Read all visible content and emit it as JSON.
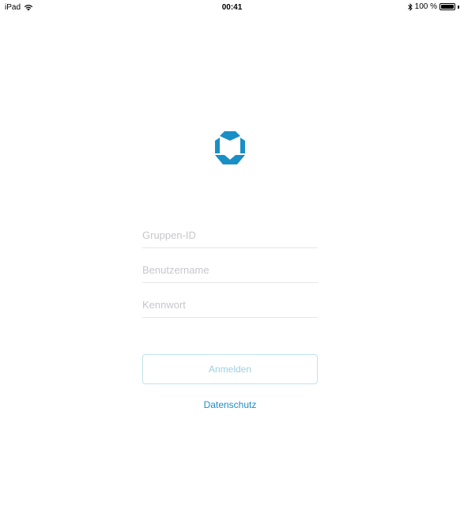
{
  "status_bar": {
    "device": "iPad",
    "time": "00:41",
    "battery_text": "100 %",
    "battery_level": 1.0
  },
  "logo": {
    "icon": "app-logo-hexagon",
    "color": "#1a8fc6"
  },
  "form": {
    "group_id_placeholder": "Gruppen-ID",
    "username_placeholder": "Benutzername",
    "password_placeholder": "Kennwort",
    "login_label": "Anmelden",
    "privacy_label": "Datenschutz"
  }
}
